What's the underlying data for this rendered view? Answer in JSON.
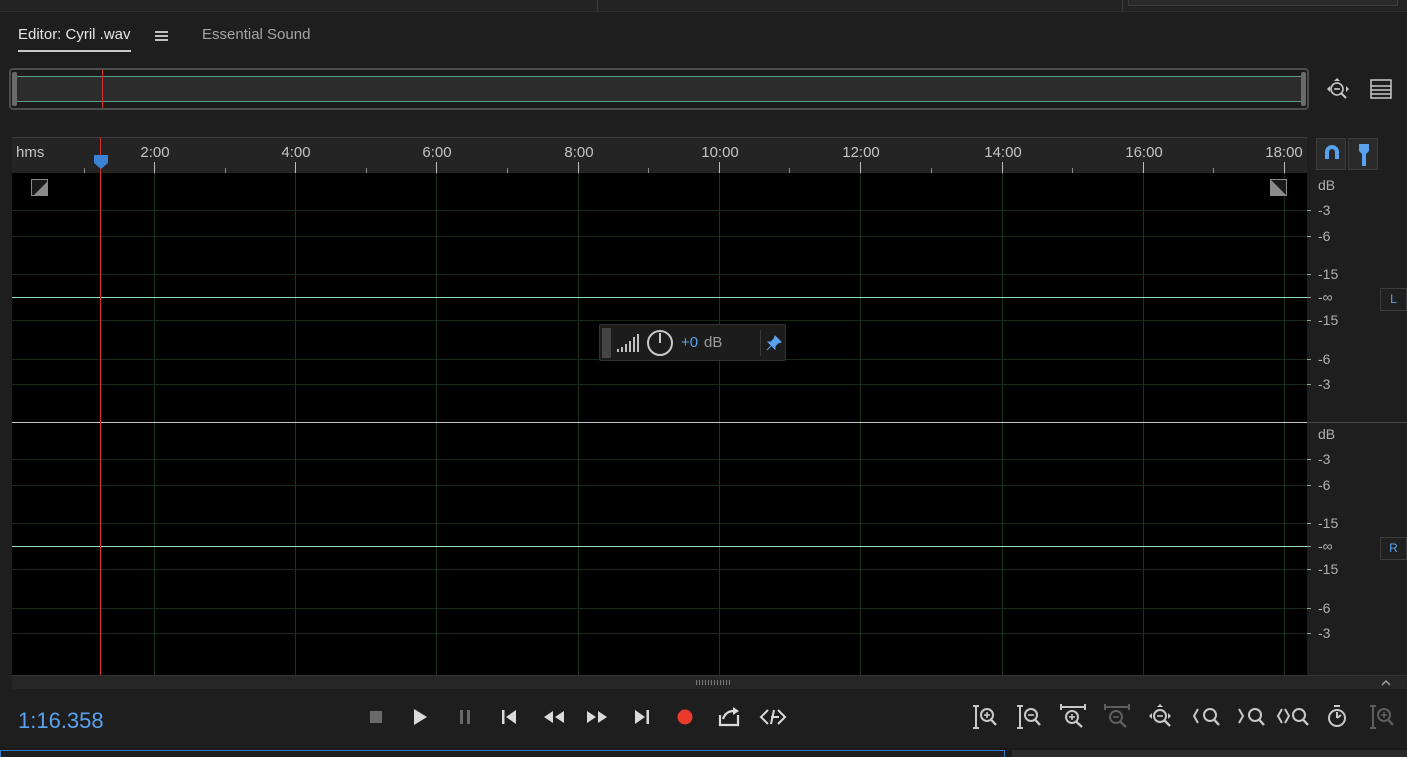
{
  "tabs": [
    {
      "label": "Editor: Cyril .wav",
      "active": true
    },
    {
      "label": "Essential Sound",
      "active": false
    }
  ],
  "ruler": {
    "units_label": "hms",
    "ticks": [
      "2:00",
      "4:00",
      "6:00",
      "8:00",
      "10:00",
      "12:00",
      "14:00",
      "16:00",
      "18:00"
    ]
  },
  "amplitude_hud": {
    "value": "+0",
    "unit": "dB"
  },
  "db_scale": {
    "left": [
      "dB",
      "-3",
      "-6",
      "-15",
      "-∞",
      "-15",
      "-6",
      "-3"
    ],
    "right": [
      "dB",
      "-3",
      "-6",
      "-15",
      "-∞",
      "-15",
      "-6",
      "-3"
    ]
  },
  "channels": {
    "left": "L",
    "right": "R"
  },
  "transport": {
    "time": "1:16.358"
  },
  "icons": {
    "transport": [
      "stop-icon",
      "play-icon",
      "pause-icon",
      "skip-to-start-icon",
      "rewind-icon",
      "fast-forward-icon",
      "skip-to-end-icon",
      "record-icon",
      "loop-playback-icon",
      "skip-selection-icon"
    ],
    "zoom": [
      "zoom-in-amplitude-icon",
      "zoom-out-amplitude-icon",
      "zoom-in-time-icon",
      "zoom-out-time-icon",
      "zoom-out-full-icon",
      "zoom-in-at-in-point-icon",
      "zoom-in-at-out-point-icon",
      "zoom-to-selection-icon",
      "zoom-to-playhead-icon",
      "zoom-in-at-mouse-icon"
    ]
  },
  "colors": {
    "accent": "#5aa1ee",
    "playhead": "#d0342c",
    "record": "#e8392b",
    "waveform_line": "#9ad9bf"
  }
}
